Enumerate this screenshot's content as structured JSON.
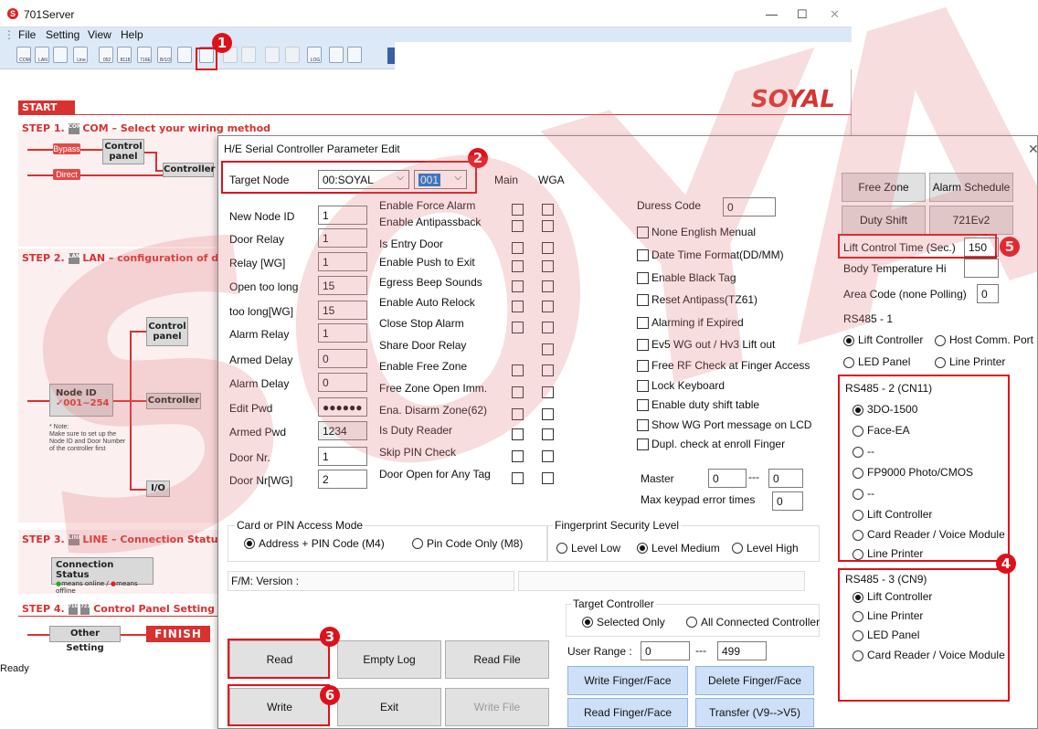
{
  "window": {
    "title": "701Server",
    "menu": [
      "File",
      "Setting",
      "View",
      "Help"
    ],
    "status": "Ready",
    "min": "—",
    "max": "☐",
    "close": "✕"
  },
  "brand": {
    "logo": "SOYAL",
    "watermark": "SOYAL"
  },
  "help": {
    "start": "START",
    "step1": "STEP 1.",
    "step1_text": "COM – Select your wiring method",
    "bypass": "Bypass",
    "direct": "Direct",
    "control_panel": "Control panel",
    "controller": "Controller",
    "step2": "STEP 2.",
    "step2_text": "LAN – configuration of devices a",
    "node_id_title": "Node ID",
    "node_id_range": "✓001~254",
    "note": "* Note:\nMake sure to set up the\nNode ID and Door Number\nof the controller first",
    "io": "I/O",
    "step3": "STEP 3.",
    "step3_text": "LINE – Connection Status",
    "conn_status": "Connection Status",
    "conn_legend_online": "means online /",
    "conn_legend_offline": "means offline",
    "step4": "STEP 4.",
    "step4_text": "Control Panel Setting",
    "other_setting": "Other Setting",
    "finish": "FINISH",
    "icon_lan": "LAN",
    "icon_line": "LINE",
    "icon_com": "COM",
    "icon_716e": "716E",
    "icon_721e": "721E"
  },
  "toolbar": {
    "icons": [
      "com-icon",
      "lan-icon",
      "refresh-icon",
      "line-icon",
      "052-icon",
      "8118-icon",
      "716e-icon",
      "b7-icon",
      "printer-icon",
      "param-edit-icon",
      "pen-icon",
      "finger-icon",
      "map-icon",
      "arrow-icon",
      "log-icon",
      "info-icon",
      "search-icon"
    ],
    "labels": [
      "COM",
      "LAN",
      "",
      "Line",
      "052",
      "8118",
      "716E",
      "B/1/3",
      "",
      "",
      "",
      "",
      "",
      "",
      "LOG",
      "",
      ""
    ]
  },
  "dialog": {
    "title": "H/E Serial Controller  Parameter Edit",
    "close": "✕",
    "target_node_label": "Target Node",
    "target_node_value": "00:SOYAL",
    "node_select": "001",
    "col_main": "Main",
    "col_wga": "WGA",
    "params": [
      {
        "label": "New Node ID",
        "value": "1"
      },
      {
        "label": "Door Relay",
        "value": "1"
      },
      {
        "label": "Relay [WG]",
        "value": "1"
      },
      {
        "label": "Open too long",
        "value": "15"
      },
      {
        "label": "too long[WG]",
        "value": "15"
      },
      {
        "label": "Alarm Relay",
        "value": "1"
      },
      {
        "label": "Armed Delay",
        "value": "0"
      },
      {
        "label": "Alarm Delay",
        "value": "0"
      },
      {
        "label": "Edit Pwd",
        "value": "●●●●●●"
      },
      {
        "label": "Armed Pwd",
        "value": "1234"
      },
      {
        "label": "Door Nr.",
        "value": "1"
      },
      {
        "label": "Door Nr[WG]",
        "value": "2"
      }
    ],
    "options": [
      {
        "label": "Enable Force Alarm",
        "main": true,
        "wga": true
      },
      {
        "label": "Enable Antipassback",
        "main": true,
        "wga": true
      },
      {
        "label": "Is Entry Door",
        "main": true,
        "wga": true
      },
      {
        "label": "Enable Push to Exit",
        "main": true,
        "wga": true
      },
      {
        "label": "Egress Beep Sounds",
        "main": true,
        "wga": true
      },
      {
        "label": "Enable Auto Relock",
        "main": true,
        "wga": true
      },
      {
        "label": "Close Stop Alarm",
        "main": true,
        "wga": true
      },
      {
        "label": "Share Door Relay",
        "main": false,
        "wga": true
      },
      {
        "label": "Enable Free Zone",
        "main": true,
        "wga": true
      },
      {
        "label": "Free Zone Open Imm.",
        "main": true,
        "wga": true
      },
      {
        "label": "Ena. Disarm Zone(62)",
        "main": true,
        "wga": true
      },
      {
        "label": "Is Duty Reader",
        "main": true,
        "wga": true
      },
      {
        "label": "Skip PIN Check",
        "main": true,
        "wga": true
      },
      {
        "label": "Door Open for Any Tag",
        "main": true,
        "wga": true
      }
    ],
    "duress_label": "Duress Code",
    "duress_value": "0",
    "right_checks": [
      "None English Menual",
      "Date Time Format(DD/MM)",
      "Enable Black Tag",
      "Reset Antipass(TZ61)",
      "Alarming if Expired",
      "Ev5 WG out / Hv3 Lift out",
      "Free RF Check at Finger Access",
      "Lock Keyboard",
      "Enable duty shift table",
      "Show WG Port message on LCD",
      "Dupl. check at enroll  Finger"
    ],
    "master_label": "Master",
    "master_a": "0",
    "master_sep": "---",
    "master_b": "0",
    "max_keypad_label": "Max keypad error times",
    "max_keypad_value": "0",
    "access_mode_title": "Card or PIN Access Mode",
    "access_modes": [
      "Address + PIN Code (M4)",
      "Pin Code Only (M8)"
    ],
    "fp_title": "Fingerprint Security Level",
    "fp_levels": [
      "Level Low",
      "Level Medium",
      "Level High"
    ],
    "fm_version": "F/M: Version :",
    "target_ctrl_title": "Target Controller",
    "target_ctrl": [
      "Selected Only",
      "All Connected Controller"
    ],
    "user_range_label": "User Range :",
    "user_range_from": "0",
    "user_range_sep": "---",
    "user_range_to": "499",
    "buttons": {
      "read": "Read",
      "empty_log": "Empty Log",
      "read_file": "Read File",
      "write": "Write",
      "exit": "Exit",
      "write_file": "Write File",
      "write_finger": "Write Finger/Face",
      "delete_finger": "Delete Finger/Face",
      "read_finger": "Read Finger/Face",
      "transfer": "Transfer (V9-->V5)",
      "free_zone": "Free Zone",
      "alarm_schedule": "Alarm Schedule",
      "duty_shift": "Duty Shift",
      "model": "721Ev2"
    },
    "lift_time_label": "Lift Control Time (Sec.)",
    "lift_time_value": "150",
    "body_temp_label": "Body Temperature Hi",
    "body_temp_value": "",
    "area_code_label": "Area Code (none Polling)",
    "area_code_value": "0",
    "rs485_1_title": "RS485 - 1",
    "rs485_1": [
      "Lift Controller",
      "Host Comm. Port",
      "LED Panel",
      "Line Printer"
    ],
    "rs485_2_title": "RS485 - 2 (CN11)",
    "rs485_2": [
      "3DO-1500",
      "Face-EA",
      "--",
      "FP9000 Photo/CMOS",
      "--",
      "Lift Controller",
      "Card Reader / Voice Module",
      "Line Printer"
    ],
    "rs485_3_title": "RS485 - 3 (CN9)",
    "rs485_3": [
      "Lift Controller",
      "Line Printer",
      "LED Panel",
      "Card Reader / Voice Module"
    ]
  },
  "callouts": [
    "1",
    "2",
    "3",
    "4",
    "5",
    "6"
  ],
  "colors": {
    "callout": "#e0101a",
    "accent": "#d8312f",
    "blue_button": "#cde0f7"
  }
}
